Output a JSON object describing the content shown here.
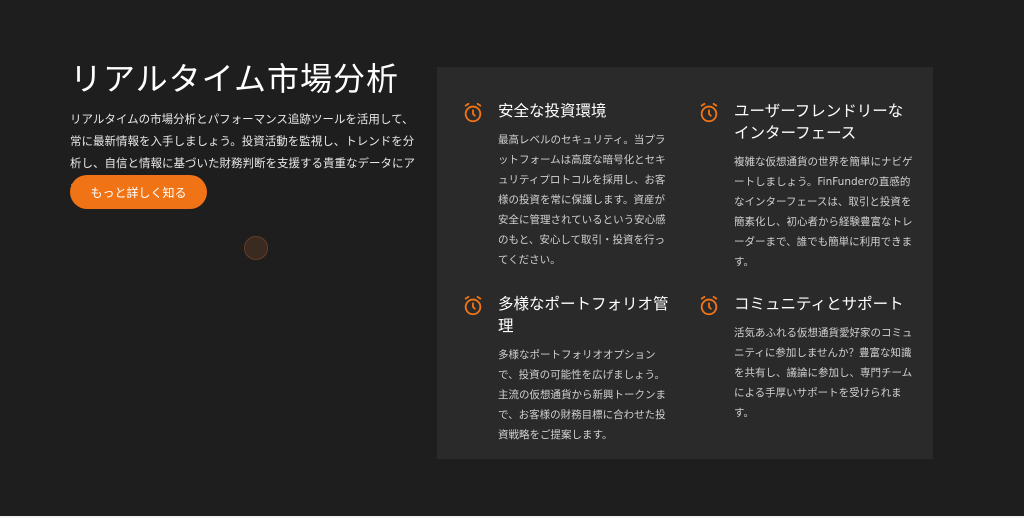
{
  "hero": {
    "title": "リアルタイム市場分析",
    "description": "リアルタイムの市場分析とパフォーマンス追跡ツールを活用して、常に最新情報を入手しましょう。投資活動を監視し、トレンドを分析し、自信と情報に基づいた財務判断を支援する貴重なデータにアクセスできます。",
    "cta_label": "もっと詳しく知る"
  },
  "accent_color": "#f07416",
  "features": [
    {
      "icon": "alarm-clock-icon",
      "title": "安全な投資環境",
      "text": "最高レベルのセキュリティ。当プラットフォームは高度な暗号化とセキュリティプロトコルを採用し、お客様の投資を常に保護します。資産が安全に管理されているという安心感のもと、安心して取引・投資を行ってください。"
    },
    {
      "icon": "alarm-clock-icon",
      "title": "ユーザーフレンドリーなインターフェース",
      "text": "複雑な仮想通貨の世界を簡単にナビゲートしましょう。FinFunderの直感的なインターフェースは、取引と投資を簡素化し、初心者から経験豊富なトレーダーまで、誰でも簡単に利用できます。"
    },
    {
      "icon": "alarm-clock-icon",
      "title": "多様なポートフォリオ管理",
      "text": "多様なポートフォリオオプションで、投資の可能性を広げましょう。主流の仮想通貨から新興トークンまで、お客様の財務目標に合わせた投資戦略をご提案します。"
    },
    {
      "icon": "alarm-clock-icon",
      "title": "コミュニティとサポート",
      "text": "活気あふれる仮想通貨愛好家のコミュニティに参加しませんか？豊富な知識を共有し、議論に参加し、専門チームによる手厚いサポートを受けられます。"
    }
  ]
}
